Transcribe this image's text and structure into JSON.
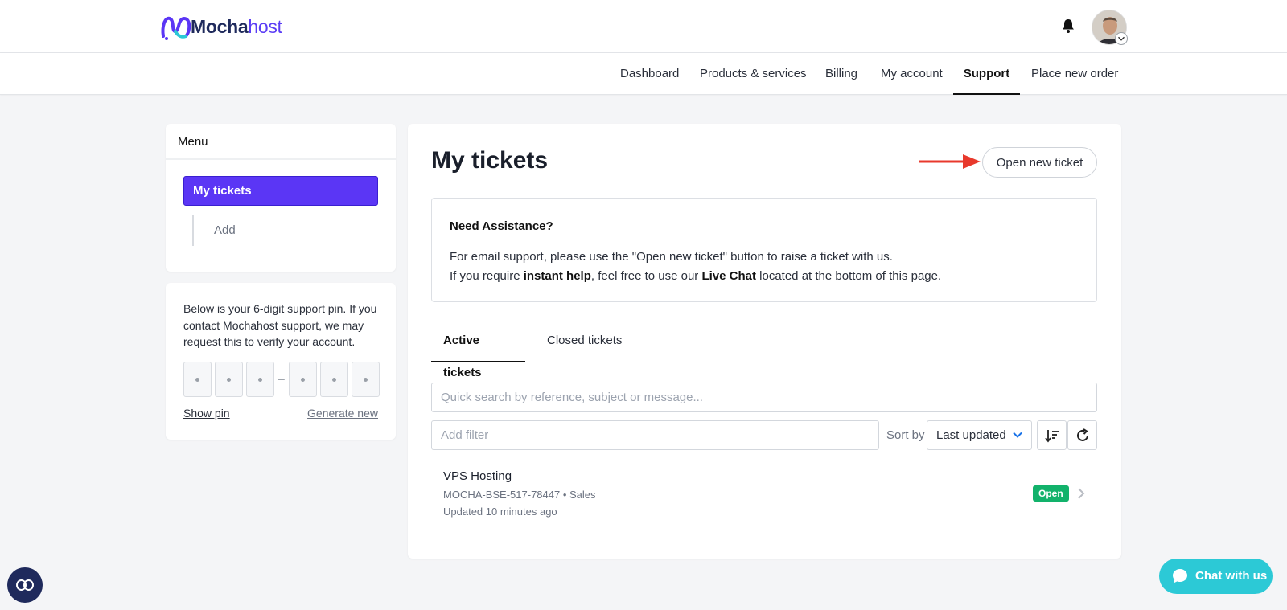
{
  "brand": {
    "part1": "Mocha",
    "part2": "host",
    "accent": "#5b36f5"
  },
  "nav": {
    "items": [
      {
        "label": "Dashboard"
      },
      {
        "label": "Products & services"
      },
      {
        "label": "Billing"
      },
      {
        "label": "My account"
      },
      {
        "label": "Support",
        "active": true
      },
      {
        "label": "Place new order"
      }
    ]
  },
  "sidebar": {
    "menu_title": "Menu",
    "items": [
      {
        "label": "My tickets",
        "active": true
      },
      {
        "label": "Add"
      }
    ],
    "pin": {
      "description": "Below is your 6-digit support pin. If you contact Mochahost support, we may request this to verify your account.",
      "separator": "–",
      "show_label": "Show pin",
      "generate_label": "Generate new"
    }
  },
  "main": {
    "title": "My tickets",
    "open_new_ticket_label": "Open new ticket",
    "assist": {
      "title": "Need Assistance?",
      "line1": "For email support, please use the \"Open new ticket\" button to raise a ticket with us.",
      "line2_pre": "If you require ",
      "line2_bold1": "instant help",
      "line2_mid": ", feel free to use our ",
      "line2_bold2": "Live Chat",
      "line2_post": " located at the bottom of this page."
    },
    "tabs": [
      {
        "label": "Active tickets",
        "active": true
      },
      {
        "label": "Closed tickets"
      }
    ],
    "search_placeholder": "Quick search by reference, subject or message...",
    "filter_placeholder": "Add filter",
    "sort_label": "Sort by",
    "sort_value": "Last updated",
    "tickets": [
      {
        "subject": "VPS Hosting",
        "reference": "MOCHA-BSE-517-78447",
        "department": "Sales",
        "updated_prefix": "Updated ",
        "updated_time": "10 minutes ago",
        "status": "Open",
        "status_color": "#12b26b"
      }
    ]
  },
  "chat": {
    "label": "Chat with us",
    "color": "#2cc9d6"
  }
}
